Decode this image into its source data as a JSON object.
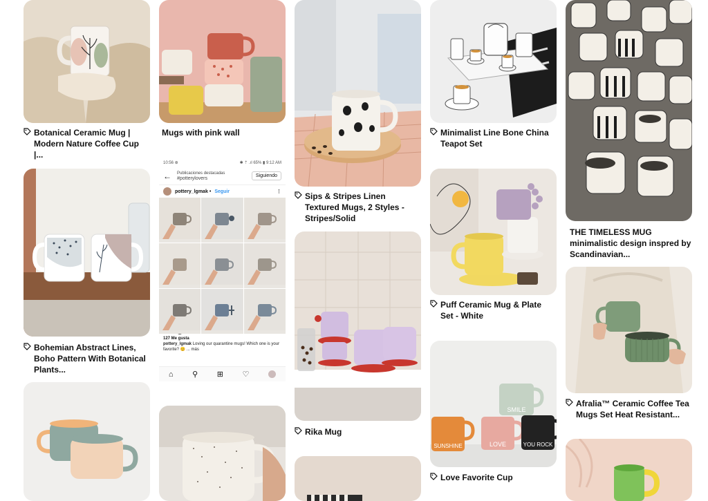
{
  "pins": [
    {
      "caption": "Botanical Ceramic Mug | Modern Nature Coffee Cup |..."
    },
    {
      "caption": "Mugs with pink wall"
    },
    {
      "caption": "Sips & Stripes Linen Textured Mugs, 2 Styles - Stripes/Solid"
    },
    {
      "caption": "Minimalist Line Bone China Teapot Set"
    },
    {
      "caption": "THE TIMELESS MUG minimalistic design inspred by Scandinavian..."
    },
    {
      "caption": "Bohemian Abstract Lines, Boho Pattern With Botanical Plants..."
    },
    {
      "caption": "Puff Ceramic Mug & Plate Set - White"
    },
    {
      "caption": "Rika Mug"
    },
    {
      "caption": "Afralia™ Ceramic Coffee Tea Mugs Set Heat Resistant..."
    },
    {
      "caption": "Love Favorite Cup"
    }
  ],
  "instagram": {
    "status_left": "10:56 ⊕",
    "status_right": "✱ ⇡ .ıl 65% ▮ 9:12 AM",
    "header_line1": "Publicaciones destacadas",
    "header_line2": "#potterylovers",
    "follow_button": "Siguiendo",
    "username": "pottery_lgmak",
    "follow_link": "Seguir",
    "likes": "127 Me gusta",
    "caption_user": "pottery_lgmak",
    "caption_text": "Loving our quarantine mugs! Which one is your favorite? 😊 ... más"
  },
  "mug_labels": {
    "sunshine": "SUNSHINE",
    "love": "LOVE",
    "smile": "SMILE",
    "you_rock": "YOU ROCK"
  },
  "icons": {
    "pin_tag": "tag-icon",
    "back": "arrow-left-icon",
    "more": "more-icon",
    "like": "heart-icon",
    "comment": "comment-icon",
    "share": "share-icon",
    "save": "bookmark-icon",
    "home": "home-icon",
    "search": "search-icon",
    "add": "plus-square-icon",
    "activity": "heart-icon"
  },
  "colors": {
    "background": "#ffffff",
    "caption_text": "#111111",
    "ig_link": "#3897f0"
  }
}
